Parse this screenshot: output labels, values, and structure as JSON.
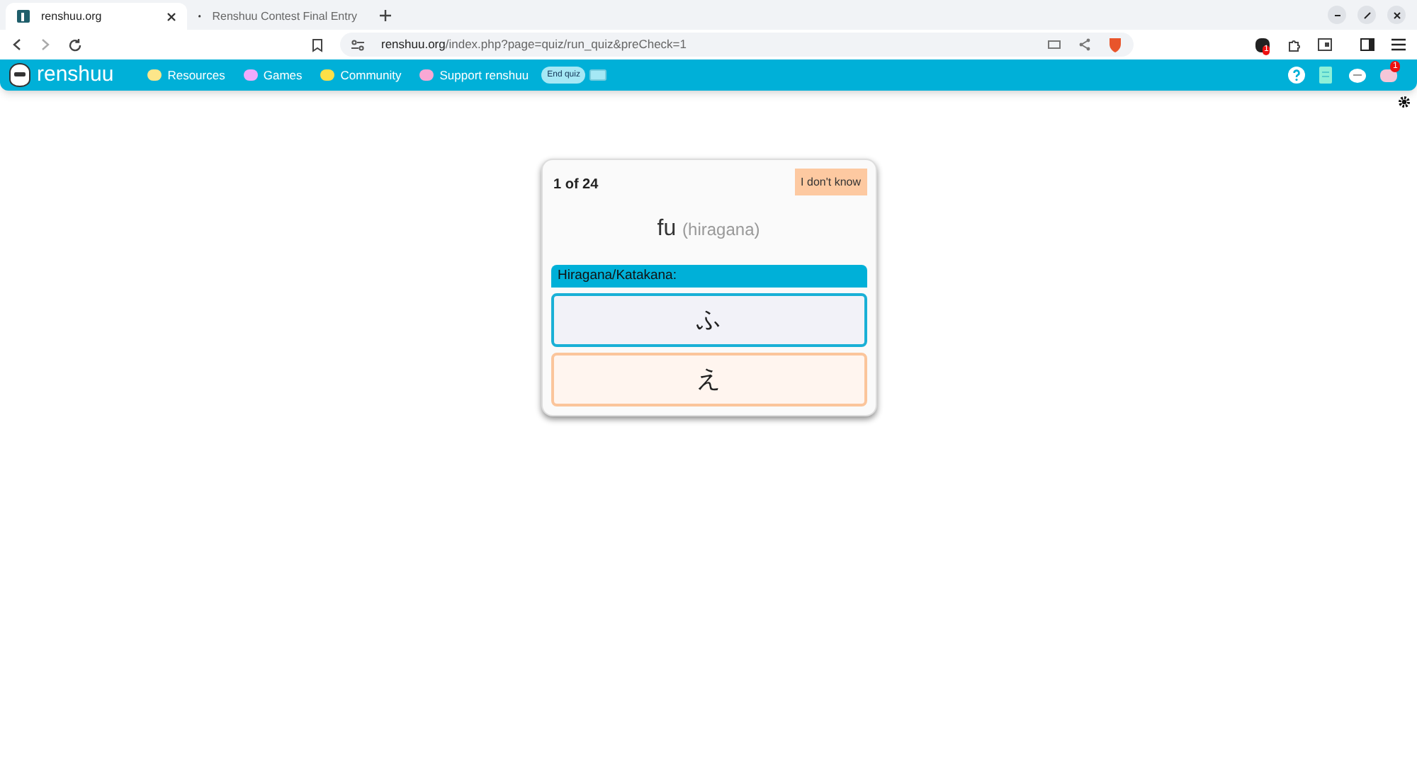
{
  "browser": {
    "tabs": [
      {
        "title": "renshuu.org",
        "selected": true
      },
      {
        "title": "Renshuu Contest Final Entry",
        "selected": false
      }
    ],
    "url_host": "renshuu.org",
    "url_path": "/index.php?page=quiz/run_quiz&preCheck=1",
    "extension_badge": "1"
  },
  "site_nav": {
    "logo": "renshuu",
    "items": [
      {
        "label": "Resources",
        "color": "#fde68a"
      },
      {
        "label": "Games",
        "color": "#f0abfc"
      },
      {
        "label": "Community",
        "color": "#fde047"
      },
      {
        "label": "Support renshuu",
        "color": "#f9a8d4"
      }
    ],
    "end_quiz": "End quiz",
    "mail_badge": "1"
  },
  "quiz": {
    "progress": "1 of 24",
    "dont_know": "I don't know",
    "prompt": "fu",
    "prompt_hint": "(hiragana)",
    "section": "Hiragana/Katakana:",
    "answers": [
      {
        "text": "ふ",
        "selected": true
      },
      {
        "text": "え",
        "selected": false
      }
    ]
  }
}
